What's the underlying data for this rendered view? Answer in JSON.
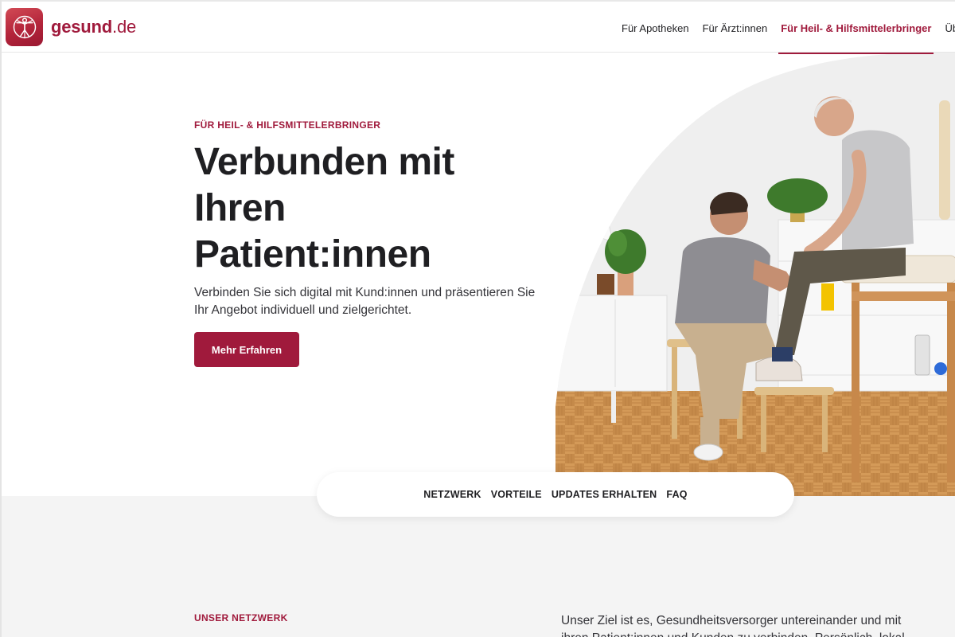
{
  "header": {
    "logo_text": "gesund",
    "logo_tld": ".de",
    "nav": [
      {
        "label": "Für Apotheken",
        "active": false
      },
      {
        "label": "Für Ärzt:innen",
        "active": false
      },
      {
        "label": "Für Heil- & Hilfsmittelerbringer",
        "active": true
      },
      {
        "label": "Über un",
        "active": false
      }
    ]
  },
  "hero": {
    "eyebrow": "FÜR HEIL- & HILFSMITTELERBRINGER",
    "title_line1": "Verbunden mit",
    "title_line2": "Ihren",
    "title_line3": "Patient:innen",
    "subtitle": "Verbinden Sie sich digital mit Kund:innen und präsentieren Sie Ihr Angebot individuell und zielgerichtet.",
    "cta_label": "Mehr Erfahren"
  },
  "subnav": {
    "items": [
      "NETZWERK",
      "VORTEILE",
      "UPDATES ERHALTEN",
      "FAQ"
    ]
  },
  "network": {
    "eyebrow": "UNSER NETZWERK",
    "body": "Unser Ziel ist es, Gesundheitsversorger untereinander und mit ihren Patient:innen und Kunden zu verbinden. Persönlich, lokal"
  },
  "colors": {
    "brand": "#a01a3c",
    "section_bg": "#f4f4f4"
  }
}
